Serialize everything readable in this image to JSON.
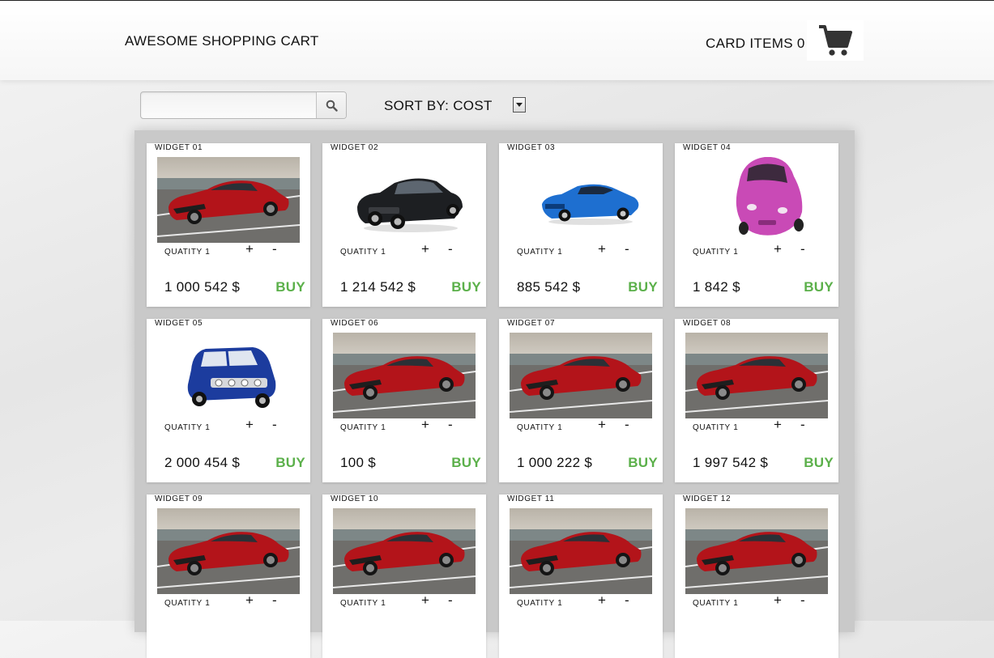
{
  "header": {
    "brand": "AWESOME SHOPPING CART",
    "card_items_label": "CARD ITEMS",
    "card_items_count": "0",
    "cart_icon": "shopping-cart-icon"
  },
  "toolbar": {
    "search_value": "",
    "search_icon": "magnifier-icon",
    "sort_label": "SORT BY:",
    "sort_value": "COST"
  },
  "colors": {
    "buy": "#5bb04a"
  },
  "products": [
    {
      "title": "WIDGET 01",
      "qty_label": "QUATITY",
      "qty": "1",
      "plus": "+",
      "minus": "-",
      "price": "1 000 542 $",
      "buy": "BUY",
      "image": "red-sedan-photo"
    },
    {
      "title": "WIDGET 02",
      "qty_label": "QUATITY",
      "qty": "1",
      "plus": "+",
      "minus": "-",
      "price": "1 214 542 $",
      "buy": "BUY",
      "image": "black-sedan"
    },
    {
      "title": "WIDGET 03",
      "qty_label": "QUATITY",
      "qty": "1",
      "plus": "+",
      "minus": "-",
      "price": "885 542 $",
      "buy": "BUY",
      "image": "blue-coupe"
    },
    {
      "title": "WIDGET 04",
      "qty_label": "QUATITY",
      "qty": "1",
      "plus": "+",
      "minus": "-",
      "price": "1 842 $",
      "buy": "BUY",
      "image": "pink-hatchback"
    },
    {
      "title": "WIDGET 05",
      "qty_label": "QUATITY",
      "qty": "1",
      "plus": "+",
      "minus": "-",
      "price": "2 000 454 $",
      "buy": "BUY",
      "image": "blue-mini"
    },
    {
      "title": "WIDGET 06",
      "qty_label": "QUATITY",
      "qty": "1",
      "plus": "+",
      "minus": "-",
      "price": "100 $",
      "buy": "BUY",
      "image": "red-sedan-photo"
    },
    {
      "title": "WIDGET 07",
      "qty_label": "QUATITY",
      "qty": "1",
      "plus": "+",
      "minus": "-",
      "price": "1 000 222 $",
      "buy": "BUY",
      "image": "red-sedan-photo"
    },
    {
      "title": "WIDGET 08",
      "qty_label": "QUATITY",
      "qty": "1",
      "plus": "+",
      "minus": "-",
      "price": "1 997 542 $",
      "buy": "BUY",
      "image": "red-sedan-photo"
    },
    {
      "title": "WIDGET 09",
      "qty_label": "QUATITY",
      "qty": "1",
      "plus": "+",
      "minus": "-",
      "price": "",
      "buy": "",
      "image": "red-sedan-photo"
    },
    {
      "title": "WIDGET 10",
      "qty_label": "QUATITY",
      "qty": "1",
      "plus": "+",
      "minus": "-",
      "price": "",
      "buy": "",
      "image": "red-sedan-photo"
    },
    {
      "title": "WIDGET 11",
      "qty_label": "QUATITY",
      "qty": "1",
      "plus": "+",
      "minus": "-",
      "price": "",
      "buy": "",
      "image": "red-sedan-photo"
    },
    {
      "title": "WIDGET 12",
      "qty_label": "QUATITY",
      "qty": "1",
      "plus": "+",
      "minus": "-",
      "price": "",
      "buy": "",
      "image": "red-sedan-photo"
    }
  ]
}
